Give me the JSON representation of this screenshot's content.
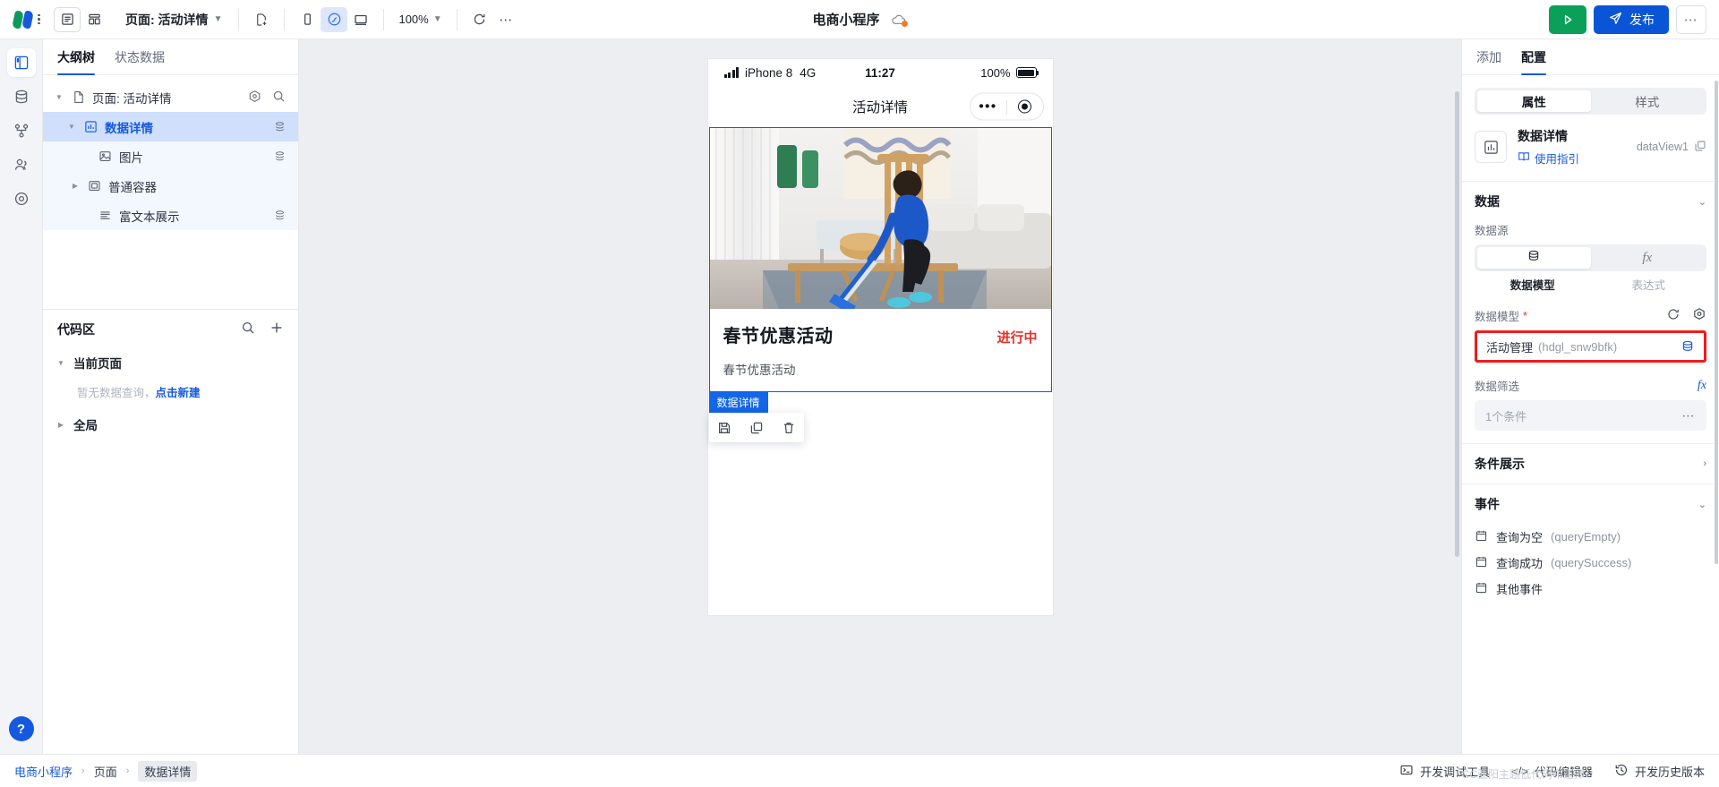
{
  "topbar": {
    "page_label": "页面: 活动详情",
    "zoom": "100%",
    "app_title": "电商小程序",
    "publish_label": "发布",
    "icons": {
      "outline_view": "list-view-icon",
      "grid_view": "grid-view-icon",
      "new_page": "new-page-icon",
      "device_phone": "phone-device-icon",
      "device_mini": "miniprogram-device-icon",
      "device_desktop": "desktop-device-icon",
      "refresh": "refresh-icon",
      "more": "more-horizontal-icon",
      "cloud": "cloud-sync-icon",
      "run": "run-play-icon",
      "publish": "send-plane-icon",
      "more_right": "more-options-icon"
    }
  },
  "rail": {
    "items": [
      {
        "name": "layout-panel-icon",
        "active": true
      },
      {
        "name": "database-icon",
        "active": false
      },
      {
        "name": "flow-branch-icon",
        "active": false
      },
      {
        "name": "users-icon",
        "active": false
      },
      {
        "name": "settings-target-icon",
        "active": false
      }
    ],
    "help_label": "?"
  },
  "left_panel": {
    "tabs": [
      {
        "label": "大纲树",
        "active": true
      },
      {
        "label": "状态数据",
        "active": false
      }
    ],
    "tree": [
      {
        "label": "页面: 活动详情",
        "icon": "page-icon",
        "depth": 0,
        "caret": "down",
        "selected": false,
        "badge": false,
        "head_icons": [
          "target-icon",
          "search-icon"
        ]
      },
      {
        "label": "数据详情",
        "icon": "data-detail-icon",
        "depth": 1,
        "caret": "down",
        "selected": true,
        "badge": true
      },
      {
        "label": "图片",
        "icon": "image-icon",
        "depth": 2,
        "caret": "none",
        "selected": false,
        "badge": true
      },
      {
        "label": "普通容器",
        "icon": "container-icon",
        "depth": 2,
        "caret": "right",
        "selected": false,
        "badge": false
      },
      {
        "label": "富文本展示",
        "icon": "richtext-icon",
        "depth": 2,
        "caret": "none",
        "selected": false,
        "badge": true
      }
    ],
    "code_section": {
      "title": "代码区",
      "icons": [
        "search-icon",
        "plus-icon"
      ],
      "groups": [
        {
          "label": "当前页面",
          "caret": "down",
          "empty_text": "暂无数据查询，",
          "empty_link": "点击新建"
        },
        {
          "label": "全局",
          "caret": "right"
        }
      ]
    }
  },
  "canvas": {
    "phone": {
      "status": {
        "device": "iPhone 8",
        "network": "4G",
        "time": "11:27",
        "battery": "100%"
      },
      "nav_title": "活动详情",
      "card": {
        "title": "春节优惠活动",
        "status": "进行中",
        "subtitle": "春节优惠活动"
      },
      "selection": {
        "tag": "数据详情",
        "tools": [
          "save-icon",
          "copy-icon",
          "delete-icon"
        ]
      }
    }
  },
  "right_panel": {
    "tabs": [
      {
        "label": "添加",
        "active": false
      },
      {
        "label": "配置",
        "active": true
      }
    ],
    "segment": [
      {
        "label": "属性",
        "active": true
      },
      {
        "label": "样式",
        "active": false
      }
    ],
    "component": {
      "icon": "chart-bar-icon",
      "name": "数据详情",
      "guide_label": "使用指引",
      "guide_icon": "book-icon",
      "id": "dataView1",
      "id_icon": "copy-icon"
    },
    "data_section": {
      "title": "数据",
      "chevron": "chevron-down-icon",
      "source_label": "数据源",
      "source_tabs": [
        {
          "label": "数据模型",
          "icon": "database-icon",
          "active": true
        },
        {
          "label": "表达式",
          "icon": "fx-icon",
          "active": false
        }
      ],
      "model_label": "数据模型",
      "model_required": "*",
      "model_actions": [
        "refresh-icon",
        "settings-icon"
      ],
      "model_value": "活动管理",
      "model_code": "(hdgl_snw9bfk)",
      "model_tail_icon": "database-icon",
      "filter_label": "数据筛选",
      "filter_fx": "fx",
      "filter_value": "1个条件",
      "filter_more": "more-horizontal-icon"
    },
    "condition_section": {
      "title": "条件展示",
      "chevron": "chevron-right-icon"
    },
    "event_section": {
      "title": "事件",
      "chevron": "chevron-down-icon",
      "events": [
        {
          "label": "查询为空",
          "code": "(queryEmpty)",
          "icon": "event-icon"
        },
        {
          "label": "查询成功",
          "code": "(querySuccess)",
          "icon": "event-icon"
        },
        {
          "label": "其他事件",
          "code": "",
          "icon": "event-icon"
        }
      ]
    }
  },
  "bottombar": {
    "breadcrumbs": [
      {
        "label": "电商小程序",
        "type": "link"
      },
      {
        "label": "页面",
        "type": "plain"
      },
      {
        "label": "数据详情",
        "type": "current"
      }
    ],
    "actions": [
      {
        "label": "开发调试工具",
        "icon": "debug-icon"
      },
      {
        "label": "代码编辑器",
        "icon": "code-icon"
      },
      {
        "label": "开发历史版本",
        "icon": "history-icon"
      }
    ]
  },
  "watermark": "CC亚阳主题低代码布道师"
}
